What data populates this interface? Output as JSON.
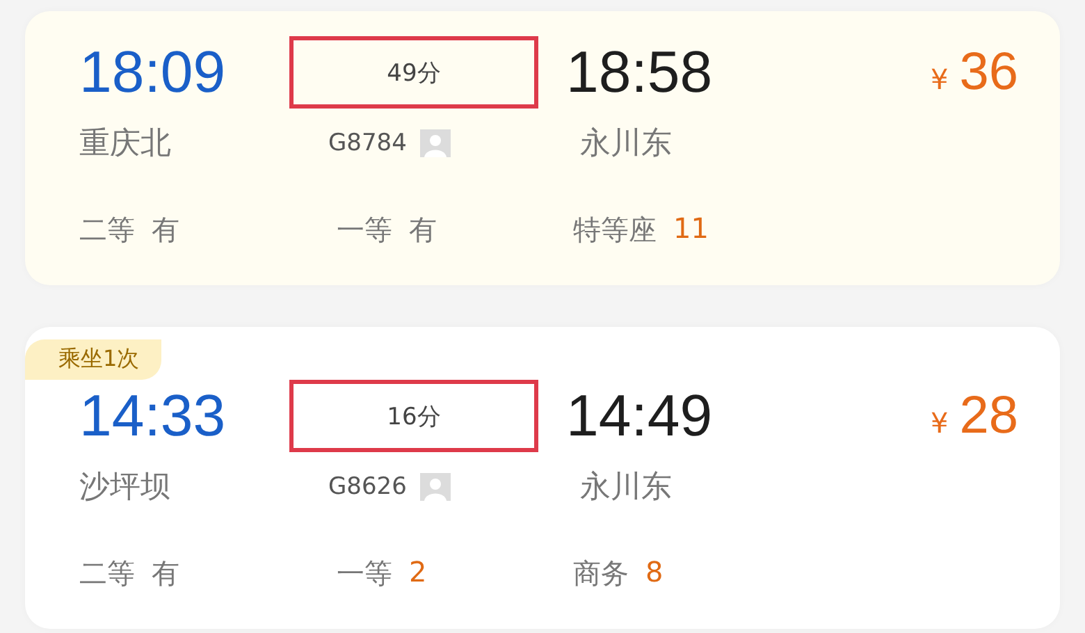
{
  "trips": [
    {
      "tinted": true,
      "depart_time": "18:09",
      "depart_station": "重庆北",
      "duration": "49分",
      "highlighted": true,
      "train": "G8784",
      "arrive_time": "18:58",
      "arrive_station": "永川东",
      "currency": "¥",
      "price": "36",
      "seats": [
        {
          "class": "二等",
          "count": "有",
          "kind": "status"
        },
        {
          "class": "一等",
          "count": "有",
          "kind": "status"
        },
        {
          "class": "特等座",
          "count": "11",
          "kind": "number"
        }
      ]
    },
    {
      "badge": "乘坐1次",
      "tinted": false,
      "depart_time": "14:33",
      "depart_station": "沙坪坝",
      "duration": "16分",
      "highlighted": true,
      "train": "G8626",
      "arrive_time": "14:49",
      "arrive_station": "永川东",
      "currency": "¥",
      "price": "28",
      "seats": [
        {
          "class": "二等",
          "count": "有",
          "kind": "status"
        },
        {
          "class": "一等",
          "count": "2",
          "kind": "number"
        },
        {
          "class": "商务",
          "count": "8",
          "kind": "number"
        }
      ]
    }
  ]
}
